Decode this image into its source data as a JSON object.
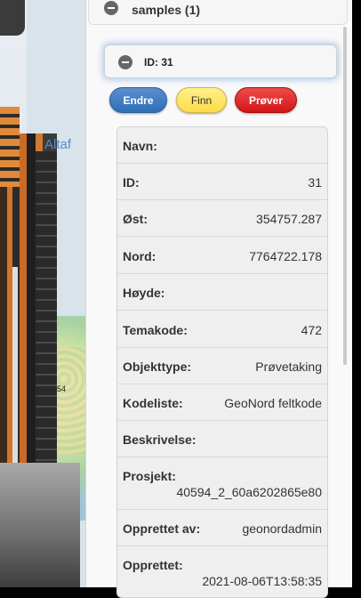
{
  "map": {
    "place_label": "Altaf",
    "small_label": "54"
  },
  "group": {
    "title": "samples (1)"
  },
  "selected": {
    "id_label": "ID: 31"
  },
  "buttons": {
    "endre": "Endre",
    "finn": "Finn",
    "prover": "Prøver"
  },
  "properties": [
    {
      "label": "Navn:",
      "value": ""
    },
    {
      "label": "ID:",
      "value": "31"
    },
    {
      "label": "Øst:",
      "value": "354757.287"
    },
    {
      "label": "Nord:",
      "value": "7764722.178"
    },
    {
      "label": "Høyde:",
      "value": ""
    },
    {
      "label": "Temakode:",
      "value": "472"
    },
    {
      "label": "Objekttype:",
      "value": "Prøvetaking"
    },
    {
      "label": "Kodeliste:",
      "value": "GeoNord feltkode"
    },
    {
      "label": "Beskrivelse:",
      "value": ""
    },
    {
      "label": "Prosjekt:",
      "value": "40594_2_60a6202865e80"
    },
    {
      "label": "Opprettet av:",
      "value": "geonordadmin"
    },
    {
      "label": "Opprettet:",
      "value": "2021-08-06T13:58:35"
    }
  ]
}
